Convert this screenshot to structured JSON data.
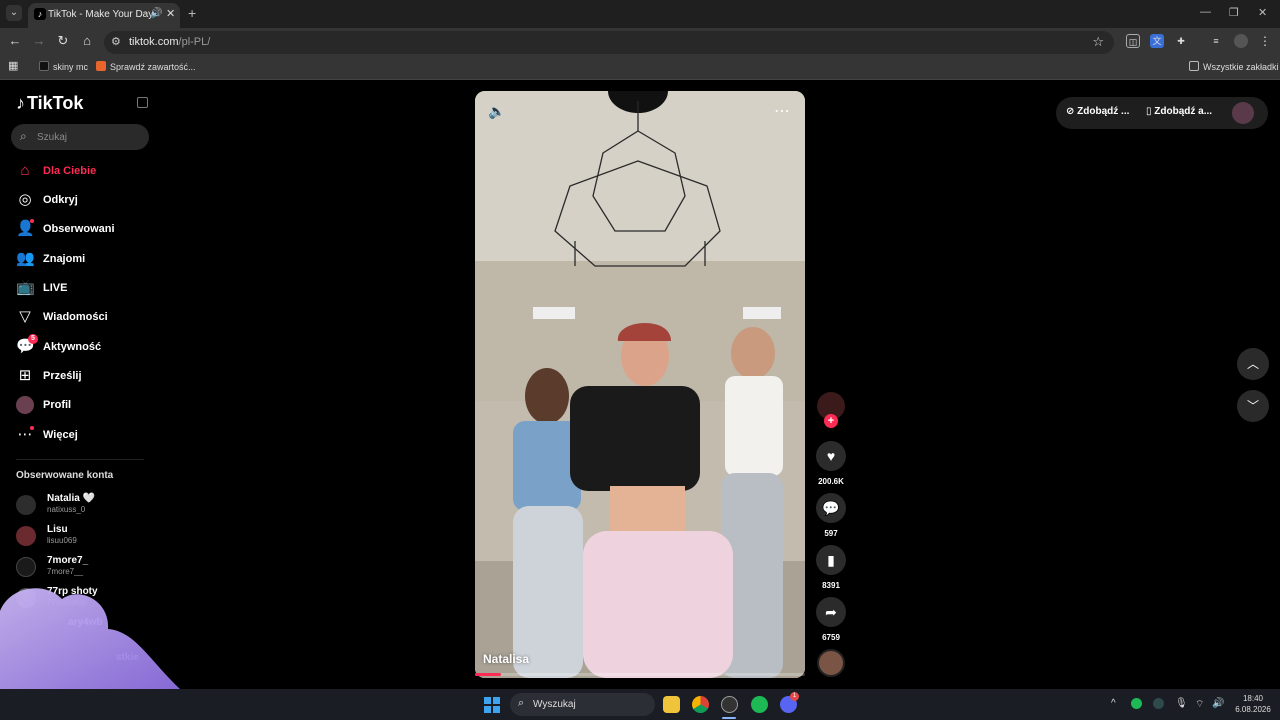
{
  "browser": {
    "tab_title": "TikTok - Make Your Day",
    "favicon_glyph": "♪",
    "url_host": "tiktok.com",
    "url_path": "/pl-PL/",
    "bookmarks": [
      {
        "label": "skiny mc",
        "color": "#111111"
      },
      {
        "label": "Sprawdź zawartość...",
        "color": "#e8652b"
      }
    ],
    "all_bookmarks_label": "Wszystkie zakładki"
  },
  "sidebar": {
    "logo": "TikTok",
    "search_placeholder": "Szukaj",
    "nav": [
      {
        "label": "Dla Ciebie",
        "icon": "home-icon",
        "active": true
      },
      {
        "label": "Odkryj",
        "icon": "compass-icon"
      },
      {
        "label": "Obserwowani",
        "icon": "user-check-icon"
      },
      {
        "label": "Znajomi",
        "icon": "friends-icon"
      },
      {
        "label": "LIVE",
        "icon": "live-icon"
      },
      {
        "label": "Wiadomości",
        "icon": "message-icon"
      },
      {
        "label": "Aktywność",
        "icon": "activity-icon",
        "badge": "5"
      },
      {
        "label": "Prześlij",
        "icon": "upload-icon"
      },
      {
        "label": "Profil",
        "icon": "avatar-icon"
      },
      {
        "label": "Więcej",
        "icon": "more-icon"
      }
    ],
    "followed_title": "Obserwowane konta",
    "followed": [
      {
        "name": "Natalia 🤍",
        "handle": "natixuss_0"
      },
      {
        "name": "Lisu",
        "handle": "lisuu069"
      },
      {
        "name": "7more7_",
        "handle": "7more7__"
      },
      {
        "name": "77rp shoty",
        "handle": "77rpshotyy"
      },
      {
        "name": "ary4wb",
        "handle": ""
      },
      {
        "name": "stkie",
        "handle": ""
      }
    ]
  },
  "video": {
    "author": "Natalisa",
    "progress_fraction": 0.08
  },
  "actions": {
    "likes": "200.6K",
    "comments": "597",
    "saves": "8391",
    "shares": "6759"
  },
  "top_right": {
    "btn1": "Zdobądź ...",
    "btn2": "Zdobądź a..."
  },
  "taskbar": {
    "search_label": "Wyszukaj",
    "discord_badge": "1",
    "time": "18:40",
    "date": "6.08.2026"
  },
  "colors": {
    "accent": "#fe2c55",
    "background": "#000000"
  }
}
